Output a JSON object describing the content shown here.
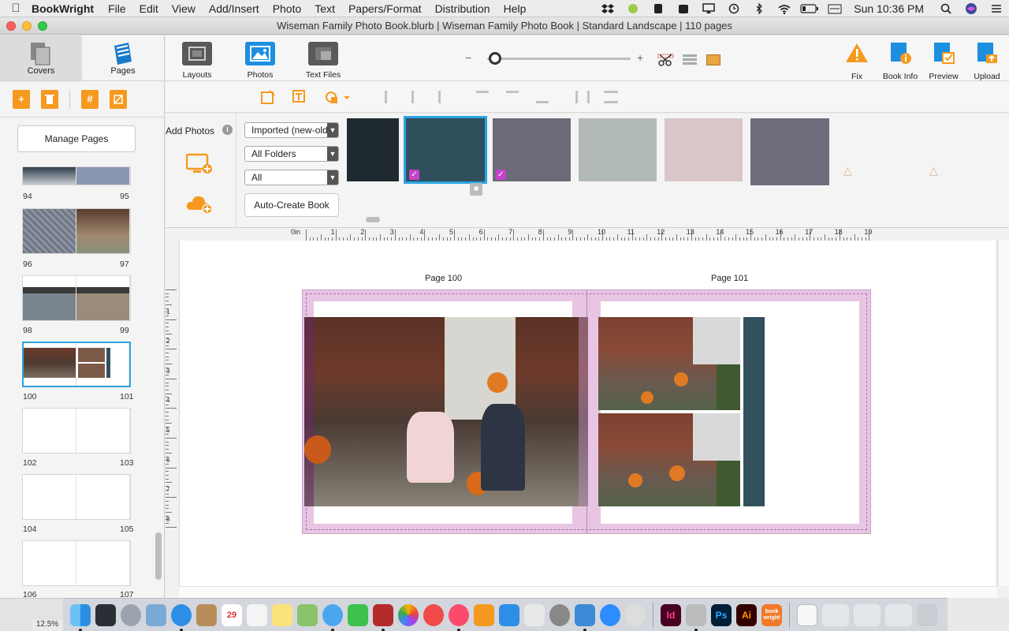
{
  "menubar": {
    "app_name": "BookWright",
    "items": [
      "File",
      "Edit",
      "View",
      "Add/Insert",
      "Photo",
      "Text",
      "Papers/Format",
      "Distribution",
      "Help"
    ],
    "clock": "Sun 10:36 PM",
    "status_icons": [
      "dropbox-icon",
      "green-circle-icon",
      "evernote-icon",
      "reminder-icon",
      "airplay-icon",
      "time-machine-icon",
      "bluetooth-icon",
      "wifi-icon",
      "battery-icon",
      "flag-icon",
      "search-icon",
      "siri-icon",
      "menu-list-icon"
    ]
  },
  "window": {
    "title": "Wiseman Family Photo Book.blurb | Wiseman Family Photo Book | Standard Landscape | 110 pages"
  },
  "left_panel": {
    "tabs": [
      {
        "label": "Covers",
        "active": true
      },
      {
        "label": "Pages",
        "active": false
      }
    ],
    "manage_pages_label": "Manage Pages",
    "spreads": [
      {
        "left": "94",
        "right": "95"
      },
      {
        "left": "96",
        "right": "97"
      },
      {
        "left": "98",
        "right": "99"
      },
      {
        "left": "100",
        "right": "101",
        "selected": true
      },
      {
        "left": "102",
        "right": "103"
      },
      {
        "left": "104",
        "right": "105"
      },
      {
        "left": "106",
        "right": "107"
      }
    ]
  },
  "toolbar": {
    "layouts_label": "Layouts",
    "photos_label": "Photos",
    "text_files_label": "Text Files",
    "zoom_minus": "−",
    "zoom_plus": "+",
    "fix_label": "Fix",
    "book_info_label": "Book Info",
    "preview_label": "Preview",
    "upload_label": "Upload"
  },
  "photos_panel": {
    "add_photos_label": "Add Photos",
    "info_glyph": "i",
    "sort_select": "Imported (new-old)",
    "folder_select": "All Folders",
    "filter_select": "All",
    "auto_create_label": "Auto-Create Book",
    "swatches": [
      {
        "color": "#1f2a30"
      },
      {
        "color": "#2f4f5d",
        "selected": true
      },
      {
        "color": "#6b6a78"
      },
      {
        "color": "#b2bab6"
      },
      {
        "color": "#d8c6c8"
      },
      {
        "color": "#6e6d7b"
      }
    ]
  },
  "canvas": {
    "ruler_unit": "0in",
    "ruler_labels": [
      "1",
      "2",
      "3",
      "4",
      "5",
      "6",
      "7",
      "8",
      "9",
      "10",
      "11",
      "12",
      "13",
      "14",
      "15",
      "16",
      "17",
      "18",
      "19"
    ],
    "vruler_labels": [
      "1",
      "2",
      "3",
      "4",
      "5",
      "6",
      "7",
      "8"
    ],
    "page_left_label": "Page 100",
    "page_right_label": "Page 101",
    "band_color": "#32505e"
  },
  "status": {
    "zoom_percent": "12.5%"
  },
  "dock": {
    "icons": [
      "finder-icon",
      "mission-control-icon",
      "launchpad-icon",
      "preview-icon",
      "safari-icon",
      "contacts-icon",
      "calendar-icon",
      "reminders-icon",
      "notes-icon",
      "maps-icon",
      "messages-icon",
      "facetime-icon",
      "photo-booth-icon",
      "photos-icon",
      "news-icon",
      "music-icon",
      "books-icon",
      "app-store-icon",
      "textedit-icon",
      "system-preferences-icon",
      "keynote-icon",
      "zoom-app-icon",
      "blocker-icon",
      "indesign-icon",
      "automator-icon",
      "photoshop-icon",
      "illustrator-icon",
      "bookwright-dock-icon",
      "document-icon",
      "window-icon",
      "window-icon",
      "window-icon",
      "trash-icon"
    ],
    "indesign_label": "Id",
    "photoshop_label": "Ps",
    "illustrator_label": "Ai",
    "bookwright_label": "book wright"
  }
}
